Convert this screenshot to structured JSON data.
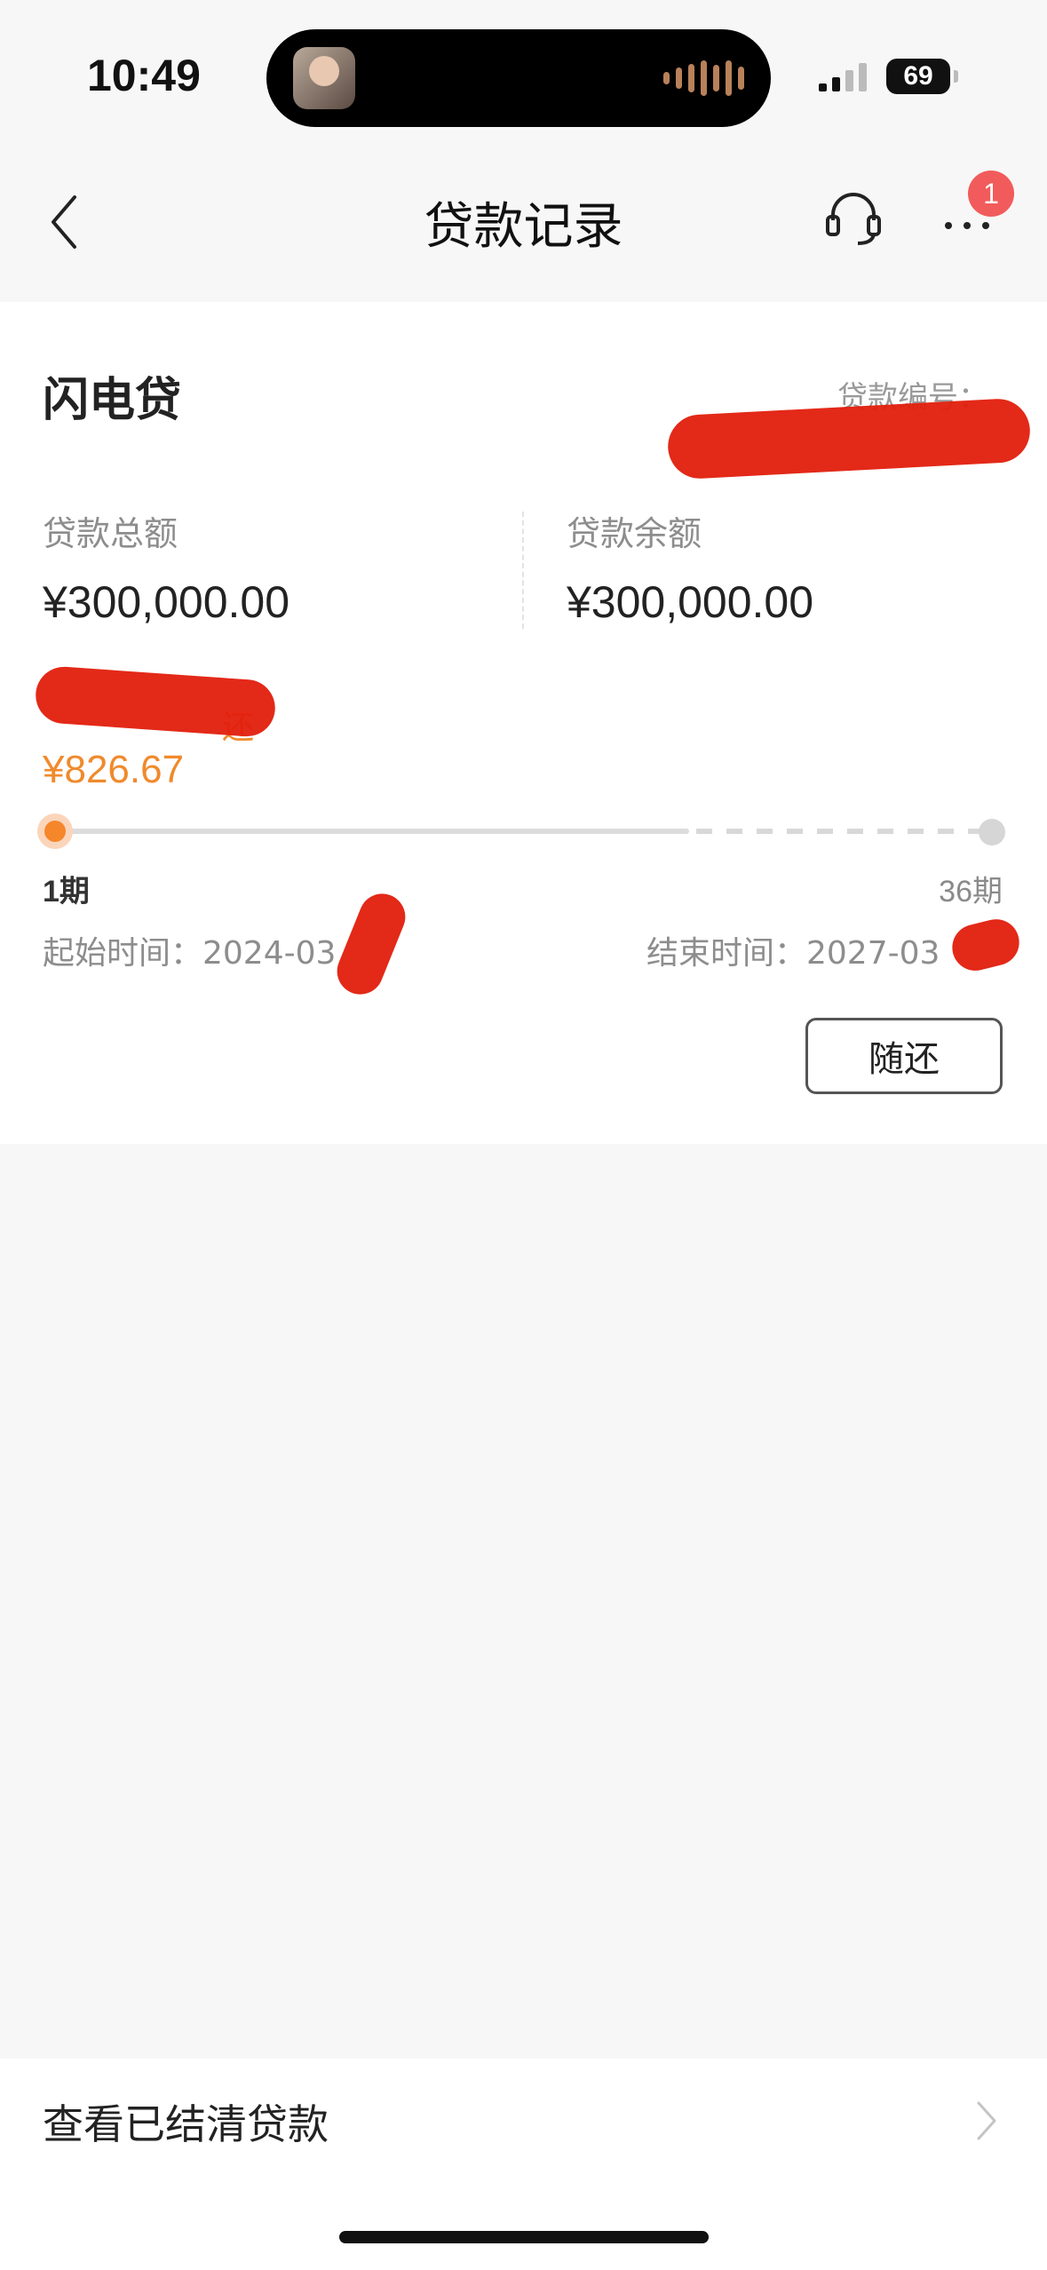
{
  "status_bar": {
    "time": "10:49",
    "battery": "69",
    "icons": [
      "signal-icon",
      "battery-icon"
    ]
  },
  "nav": {
    "title": "贷款记录",
    "back_icon": "chevron-left-icon",
    "service_icon": "headset-icon",
    "more_icon": "more-icon",
    "badge_count": "1"
  },
  "loan_card": {
    "product_name": "闪电贷",
    "loan_number_label": "贷款编号：",
    "total_label": "贷款总额",
    "total_value": "¥300,000.00",
    "balance_label": "贷款余额",
    "balance_value": "¥300,000.00",
    "repay_label_visible": "还",
    "repay_amount": "¥826.67",
    "period_start": "1期",
    "period_end": "36期",
    "start_date": "起始时间：2024-03",
    "end_date": "结束时间：2027-03",
    "repay_button": "随还",
    "accent_color": "#f08a2c"
  },
  "footer": {
    "settled_loans_label": "查看已结清贷款",
    "chevron_icon": "chevron-right-icon"
  }
}
